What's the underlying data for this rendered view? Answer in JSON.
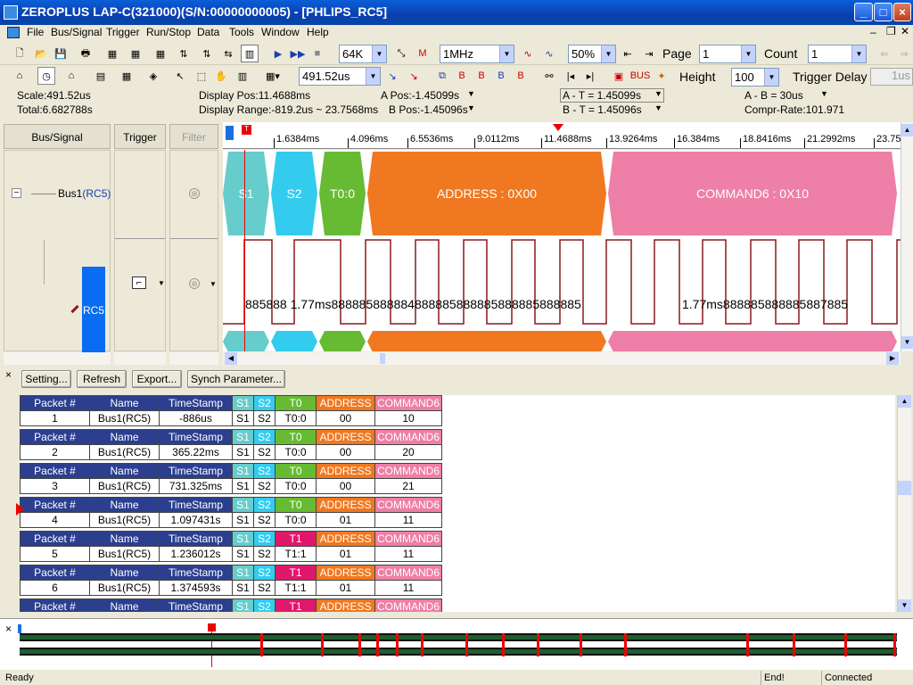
{
  "window": {
    "title": "ZEROPLUS LAP-C(321000)(S/N:00000000005) - [PHLIPS_RC5]"
  },
  "menu": [
    "File",
    "Bus/Signal",
    "Trigger",
    "Run/Stop",
    "Data",
    "Tools",
    "Window",
    "Help"
  ],
  "toolbar": {
    "memory": "64K",
    "frequency": "1MHz",
    "zoom": "50%",
    "page_label": "Page",
    "page_value": "1",
    "count_label": "Count",
    "count_value": "1",
    "time_value": "491.52us",
    "height_label": "Height",
    "height_value": "100",
    "trigger_delay_label": "Trigger Delay",
    "trigger_delay_value": "1us"
  },
  "info": {
    "scale": "Scale:491.52us",
    "total": "Total:6.682788s",
    "display_pos": "Display Pos:11.4688ms",
    "display_range": "Display Range:-819.2us ~ 23.7568ms",
    "a_pos": "A Pos:-1.45099s",
    "b_pos": "B Pos:-1.45096s",
    "a_t": "A - T = 1.45099s",
    "b_t": "B - T = 1.45096s",
    "a_b": "A - B = 30us",
    "compr_rate": "Compr-Rate:101.971"
  },
  "columns": {
    "bus_signal": "Bus/Signal",
    "trigger": "Trigger",
    "filter": "Filter"
  },
  "signals": {
    "bus1_name": "Bus1",
    "bus1_sub": "(RC5)",
    "rc5_label": "RC5"
  },
  "ruler": [
    "1.6384ms",
    "4.096ms",
    "6.5536ms",
    "9.0112ms",
    "11.4688ms",
    "13.9264ms",
    "16.384ms",
    "18.8416ms",
    "21.2992ms",
    "23.75"
  ],
  "bus_segments": [
    {
      "label": "S1",
      "color": "#66cccc"
    },
    {
      "label": "S2",
      "color": "#33ccee"
    },
    {
      "label": "T0:0",
      "color": "#66bb33"
    },
    {
      "label": "ADDRESS : 0X00",
      "color": "#f07820"
    },
    {
      "label": "COMMAND6 : 0X10",
      "color": "#ee7fa6"
    }
  ],
  "wave_text": {
    "left": "885888 1.77ms888885888884888885888885888885888885",
    "right": "1.77ms888885888885887885"
  },
  "packet_buttons": [
    "Setting...",
    "Refresh",
    "Export...",
    "Synch Parameter..."
  ],
  "packet_headers": [
    "Packet #",
    "Name",
    "TimeStamp",
    "S1",
    "S2",
    "T0",
    "T1",
    "ADDRESS",
    "COMMAND6"
  ],
  "packets": [
    {
      "num": "1",
      "name": "Bus1(RC5)",
      "ts": "-886us",
      "s1": "S1",
      "s2": "S2",
      "t": "T0:0",
      "tcol": "T0",
      "addr": "00",
      "cmd": "10"
    },
    {
      "num": "2",
      "name": "Bus1(RC5)",
      "ts": "365.22ms",
      "s1": "S1",
      "s2": "S2",
      "t": "T0:0",
      "tcol": "T0",
      "addr": "00",
      "cmd": "20"
    },
    {
      "num": "3",
      "name": "Bus1(RC5)",
      "ts": "731.325ms",
      "s1": "S1",
      "s2": "S2",
      "t": "T0:0",
      "tcol": "T0",
      "addr": "00",
      "cmd": "21"
    },
    {
      "num": "4",
      "name": "Bus1(RC5)",
      "ts": "1.097431s",
      "s1": "S1",
      "s2": "S2",
      "t": "T0:0",
      "tcol": "T0",
      "addr": "01",
      "cmd": "11"
    },
    {
      "num": "5",
      "name": "Bus1(RC5)",
      "ts": "1.236012s",
      "s1": "S1",
      "s2": "S2",
      "t": "T1:1",
      "tcol": "T1",
      "addr": "01",
      "cmd": "11"
    },
    {
      "num": "6",
      "name": "Bus1(RC5)",
      "ts": "1.374593s",
      "s1": "S1",
      "s2": "S2",
      "t": "T1:1",
      "tcol": "T1",
      "addr": "01",
      "cmd": "11"
    },
    {
      "num": "",
      "name": "",
      "ts": "",
      "s1": "",
      "s2": "",
      "t": "",
      "tcol": "T1",
      "addr": "",
      "cmd": ""
    }
  ],
  "status": {
    "ready": "Ready",
    "end": "End!",
    "connected": "Connected"
  }
}
